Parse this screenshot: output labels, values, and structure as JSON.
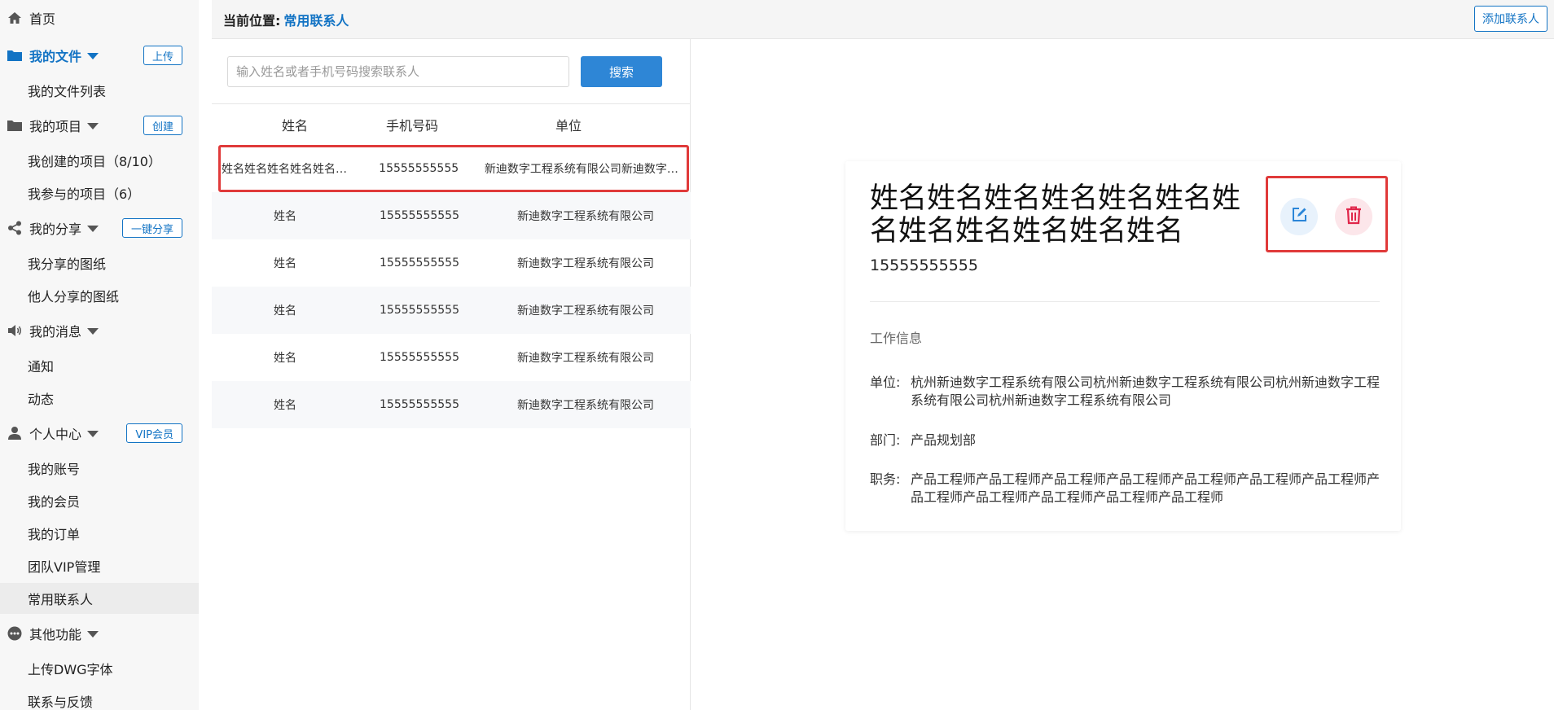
{
  "sidebar": {
    "home": "首页",
    "my_files": {
      "label": "我的文件",
      "button": "上传",
      "items": [
        "我的文件列表"
      ]
    },
    "my_projects": {
      "label": "我的项目",
      "button": "创建",
      "items": [
        "我创建的项目（8/10）",
        "我参与的项目（6）"
      ]
    },
    "my_shares": {
      "label": "我的分享",
      "button": "一键分享",
      "items": [
        "我分享的图纸",
        "他人分享的图纸"
      ]
    },
    "my_messages": {
      "label": "我的消息",
      "items": [
        "通知",
        "动态"
      ]
    },
    "personal_center": {
      "label": "个人中心",
      "button": "VIP会员",
      "items": [
        "我的账号",
        "我的会员",
        "我的订单",
        "团队VIP管理",
        "常用联系人"
      ]
    },
    "other_functions": {
      "label": "其他功能",
      "items": [
        "上传DWG字体",
        "联系与反馈"
      ]
    }
  },
  "topbar": {
    "breadcrumb_prefix": "当前位置:",
    "breadcrumb_current": "常用联系人",
    "add_contact_label": "添加联系人"
  },
  "search": {
    "placeholder": "输入姓名或者手机号码搜索联系人",
    "value": "",
    "button_label": "搜索"
  },
  "table": {
    "headers": [
      "姓名",
      "手机号码",
      "单位"
    ],
    "rows": [
      [
        "姓名姓名姓名姓名姓名姓名",
        "15555555555",
        "新迪数字工程系统有限公司新迪数字工程系统有限公司"
      ],
      [
        "姓名",
        "15555555555",
        "新迪数字工程系统有限公司"
      ],
      [
        "姓名",
        "15555555555",
        "新迪数字工程系统有限公司"
      ],
      [
        "姓名",
        "15555555555",
        "新迪数字工程系统有限公司"
      ],
      [
        "姓名",
        "15555555555",
        "新迪数字工程系统有限公司"
      ],
      [
        "姓名",
        "15555555555",
        "新迪数字工程系统有限公司"
      ]
    ],
    "selected_index": 0
  },
  "detail": {
    "name": "姓名姓名姓名姓名姓名姓名姓名姓名姓名姓名姓名姓名",
    "phone": "15555555555",
    "section_title": "工作信息",
    "company_label": "单位:",
    "company": "杭州新迪数字工程系统有限公司杭州新迪数字工程系统有限公司杭州新迪数字工程系统有限公司杭州新迪数字工程系统有限公司",
    "department_label": "部门:",
    "department": "产品规划部",
    "position_label": "职务:",
    "position": "产品工程师产品工程师产品工程师产品工程师产品工程师产品工程师产品工程师产品工程师产品工程师产品工程师产品工程师产品工程师"
  },
  "colors": {
    "accent": "#1273c4",
    "button_blue": "#2e86d6",
    "highlight_red": "#e03a3a",
    "delete_red": "#e0264a",
    "edit_blue": "#2b86d8"
  },
  "icons": {
    "home": "home-icon",
    "files": "folder-icon",
    "projects": "folder-icon",
    "share": "share-icon",
    "messages": "speaker-icon",
    "personal": "user-icon",
    "other": "more-icon",
    "edit": "edit-icon",
    "delete": "trash-icon"
  }
}
